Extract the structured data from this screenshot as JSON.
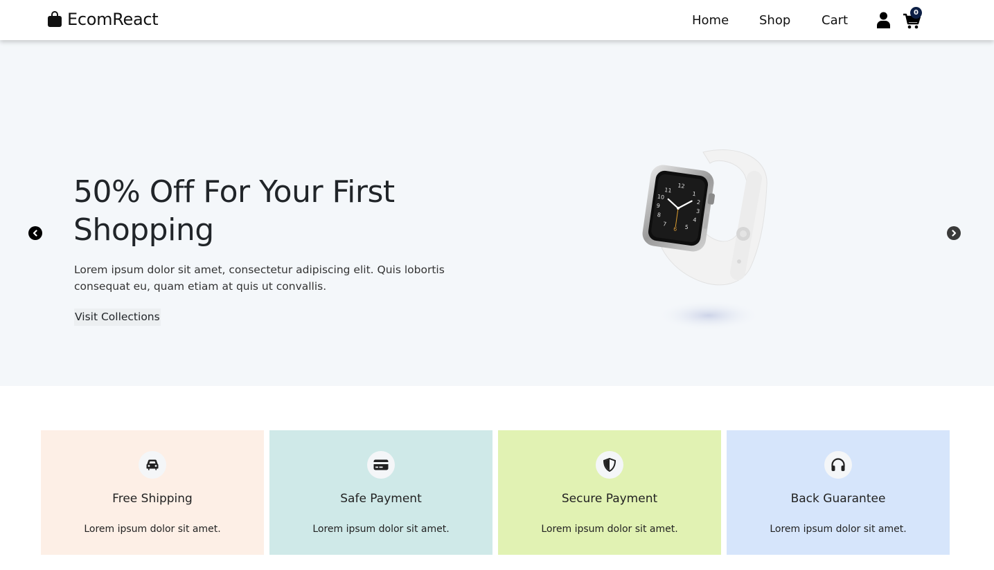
{
  "navbar": {
    "brand": "EcomReact",
    "brand_icon": "shopping-bag-icon",
    "links": [
      "Home",
      "Shop",
      "Cart"
    ],
    "user_icon": "user-icon",
    "cart_icon": "cart-icon",
    "cart_count": "0"
  },
  "hero": {
    "title": "50% Off For Your First Shopping",
    "text": "Lorem ipsum dolor sit amet, consectetur adipiscing elit. Quis lobortis consequat eu, quam etiam at quis ut convallis.",
    "button": "Visit Collections",
    "image": "smartwatch-image",
    "prev_icon": "chevron-left-circle-icon",
    "next_icon": "chevron-right-circle-icon"
  },
  "features": [
    {
      "title": "Free Shipping",
      "text": "Lorem ipsum dolor sit amet.",
      "icon": "car-icon",
      "color": "#fdefe6"
    },
    {
      "title": "Safe Payment",
      "text": "Lorem ipsum dolor sit amet.",
      "icon": "credit-card-icon",
      "color": "#cfe9e8"
    },
    {
      "title": "Secure Payment",
      "text": "Lorem ipsum dolor sit amet.",
      "icon": "shield-icon",
      "color": "#e1f2b3"
    },
    {
      "title": "Back Guarantee",
      "text": "Lorem ipsum dolor sit amet.",
      "icon": "headphones-icon",
      "color": "#d6e5fb"
    }
  ],
  "colors": {
    "hero_bg": "#f4f7fa",
    "badge_bg": "#0d1f45",
    "text": "#212529"
  }
}
